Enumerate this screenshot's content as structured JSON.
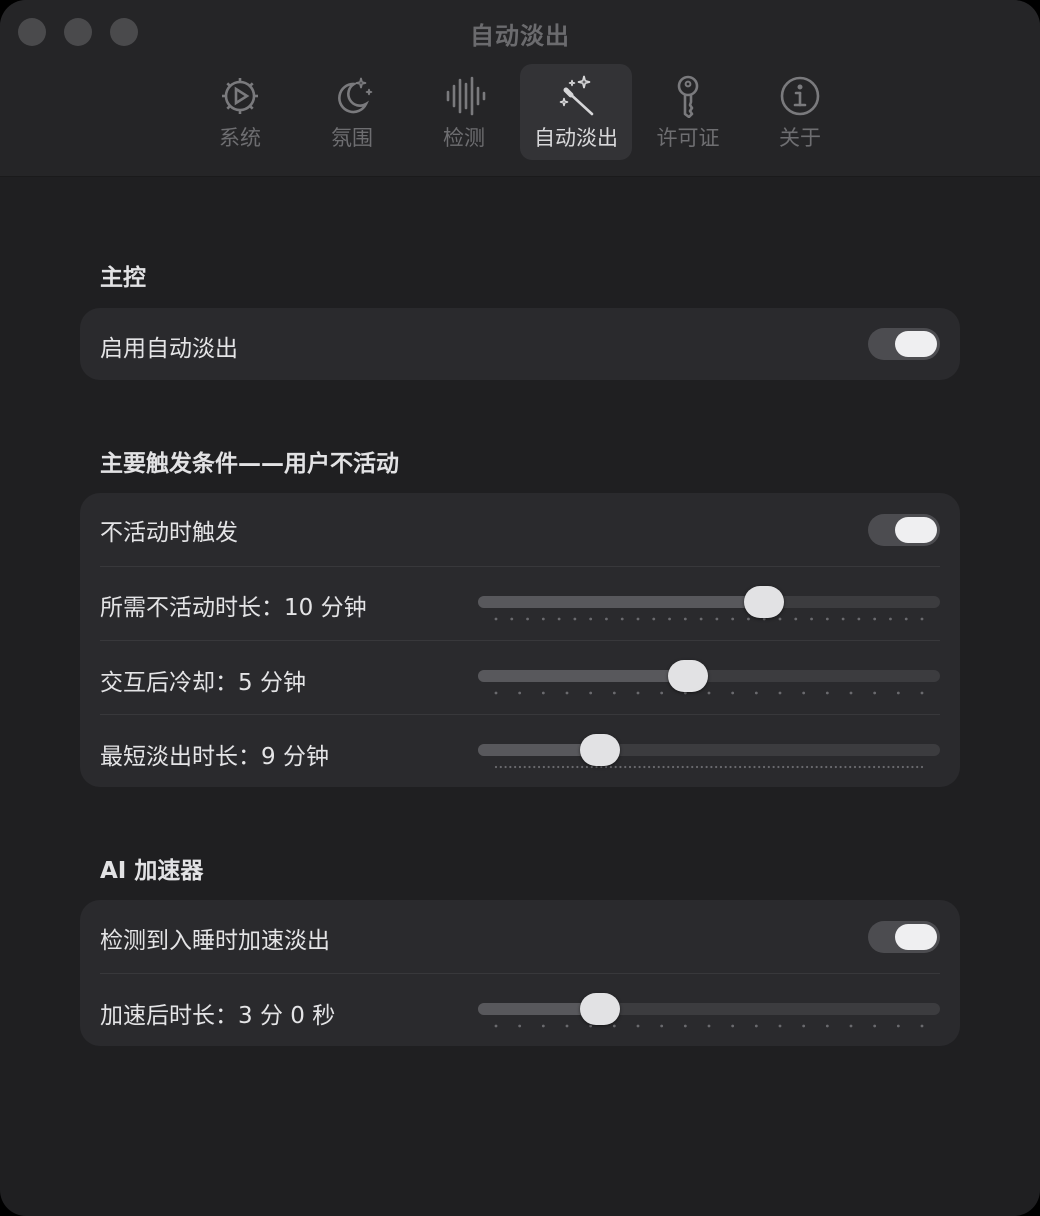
{
  "window": {
    "title": "自动淡出"
  },
  "tabs": [
    {
      "label": "系统",
      "icon": "gear-play-icon",
      "active": false
    },
    {
      "label": "氛围",
      "icon": "moon-stars-icon",
      "active": false
    },
    {
      "label": "检测",
      "icon": "waveform-icon",
      "active": false
    },
    {
      "label": "自动淡出",
      "icon": "magic-wand-icon",
      "active": true
    },
    {
      "label": "许可证",
      "icon": "key-icon",
      "active": false
    },
    {
      "label": "关于",
      "icon": "info-icon",
      "active": false
    }
  ],
  "sections": {
    "master": {
      "title": "主控",
      "enable_label": "启用自动淡出",
      "enable_on": true
    },
    "primary": {
      "title": "主要触发条件——用户不活动",
      "inactive_trigger_label": "不活动时触发",
      "inactive_trigger_on": true,
      "inactive_duration_label": "所需不活动时长：10 分钟",
      "inactive_duration_value": 0.63,
      "inactive_duration_ticks": 28,
      "cooldown_label": "交互后冷却：5 分钟",
      "cooldown_value": 0.45,
      "cooldown_ticks": 19,
      "min_fade_label": "最短淡出时长：9 分钟",
      "min_fade_value": 0.245,
      "min_fade_ticks": 90
    },
    "ai": {
      "title": "AI 加速器",
      "sleep_accel_label": "检测到入睡时加速淡出",
      "sleep_accel_on": true,
      "accel_duration_label": "加速后时长：3 分 0 秒",
      "accel_duration_value": 0.245,
      "accel_duration_ticks": 19
    }
  },
  "colors": {
    "window_bg": "#1f1f21",
    "card_bg": "#2a2a2d",
    "toggle_on": "#4c4c50",
    "thumb": "#e2e2e4"
  }
}
